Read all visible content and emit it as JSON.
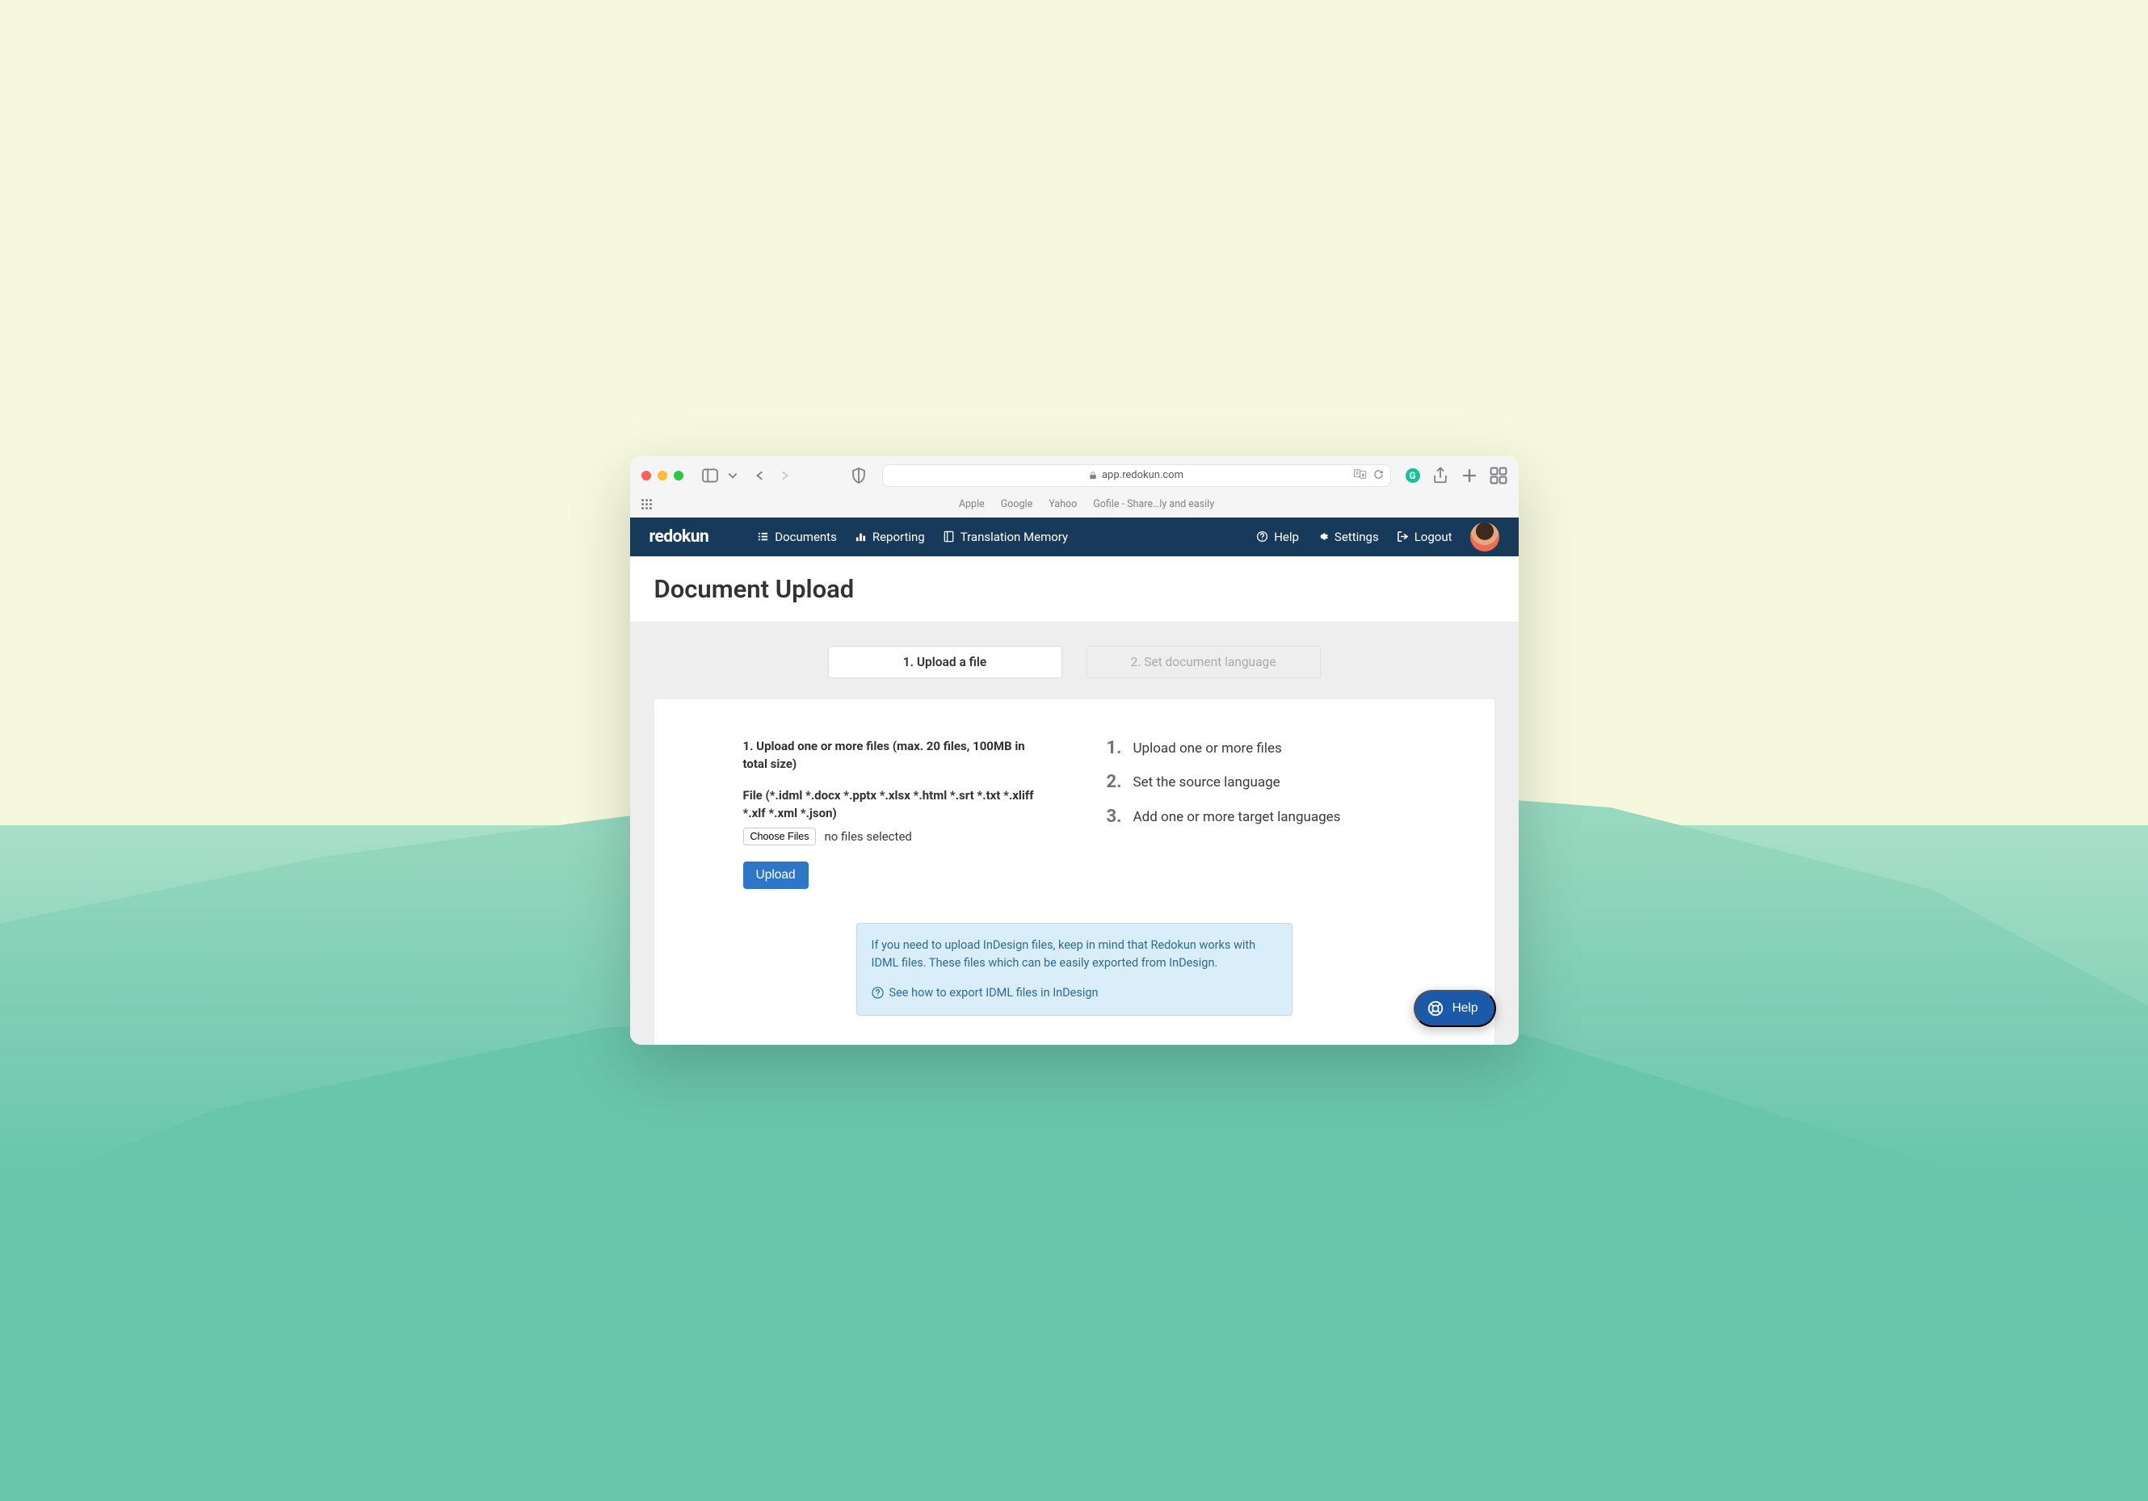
{
  "browser": {
    "url_host": "app.redokun.com",
    "bookmarks": [
      "Apple",
      "Google",
      "Yahoo",
      "Gofile - Share…ly and easily"
    ]
  },
  "header": {
    "brand": "redokun",
    "nav": {
      "documents": "Documents",
      "reporting": "Reporting",
      "tm": "Translation Memory"
    },
    "right": {
      "help": "Help",
      "settings": "Settings",
      "logout": "Logout"
    }
  },
  "page": {
    "title": "Document Upload",
    "tabs": {
      "active": "1. Upload a file",
      "inactive": "2. Set document language"
    },
    "upload": {
      "heading": "1. Upload one or more files (max. 20 files, 100MB in total size)",
      "file_label": "File (*.idml *.docx *.pptx *.xlsx *.html *.srt *.txt *.xliff *.xlf *.xml *.json)",
      "choose_label": "Choose Files",
      "file_status": "no files selected",
      "upload_btn": "Upload"
    },
    "steps": [
      "Upload one or more files",
      "Set the source language",
      "Add one or more target languages"
    ],
    "info": {
      "text": "If you need to upload InDesign files, keep in mind that Redokun works with IDML files. These files which can be easily exported from InDesign.",
      "link": "See how to export IDML files in InDesign"
    }
  },
  "fab": {
    "label": "Help"
  }
}
